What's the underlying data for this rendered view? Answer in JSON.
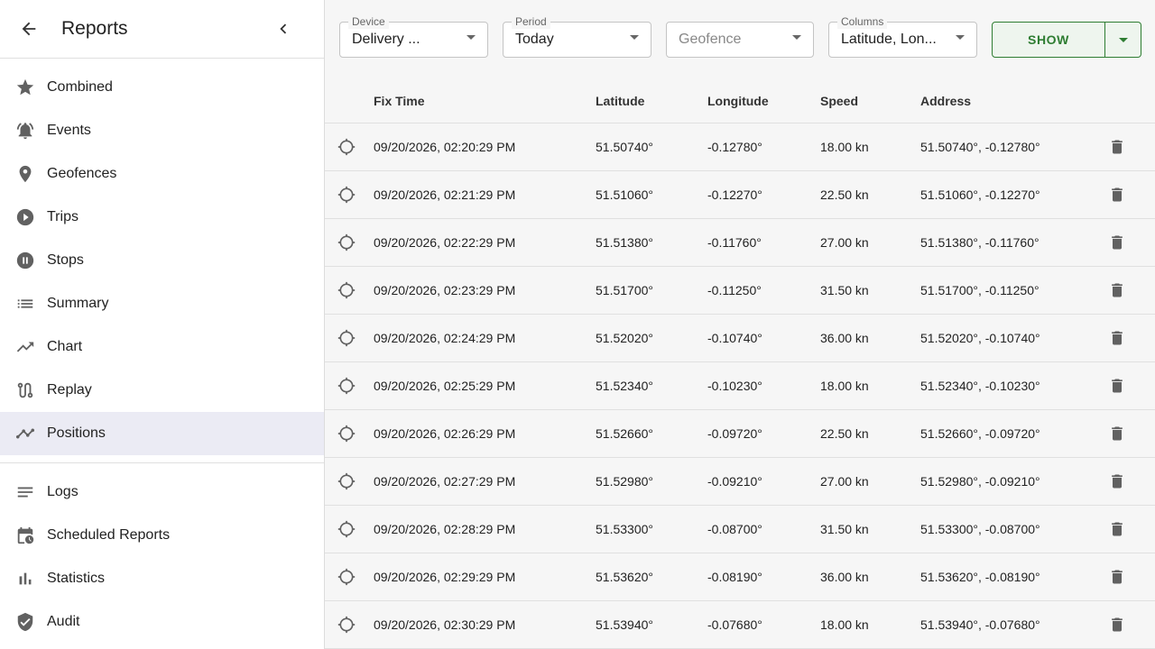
{
  "sidebar": {
    "title": "Reports",
    "top_items": [
      {
        "label": "Combined",
        "icon": "star-icon"
      },
      {
        "label": "Events",
        "icon": "bell-icon"
      },
      {
        "label": "Geofences",
        "icon": "map-pin-icon"
      },
      {
        "label": "Trips",
        "icon": "play-circle-icon"
      },
      {
        "label": "Stops",
        "icon": "pause-circle-icon"
      },
      {
        "label": "Summary",
        "icon": "list-icon"
      },
      {
        "label": "Chart",
        "icon": "trending-up-icon"
      },
      {
        "label": "Replay",
        "icon": "route-icon"
      },
      {
        "label": "Positions",
        "icon": "timeline-icon",
        "active": true
      }
    ],
    "bottom_items": [
      {
        "label": "Logs",
        "icon": "notes-icon"
      },
      {
        "label": "Scheduled Reports",
        "icon": "calendar-schedule-icon"
      },
      {
        "label": "Statistics",
        "icon": "bar-chart-icon"
      },
      {
        "label": "Audit",
        "icon": "shield-check-icon"
      }
    ]
  },
  "filters": {
    "device": {
      "label": "Device",
      "value": "Delivery ..."
    },
    "period": {
      "label": "Period",
      "value": "Today"
    },
    "geofence": {
      "placeholder": "Geofence"
    },
    "columns": {
      "label": "Columns",
      "value": "Latitude, Lon..."
    },
    "show_label": "SHOW"
  },
  "table": {
    "headers": {
      "fix_time": "Fix Time",
      "latitude": "Latitude",
      "longitude": "Longitude",
      "speed": "Speed",
      "address": "Address"
    },
    "rows": [
      {
        "fix_time": "09/20/2026, 02:20:29 PM",
        "latitude": "51.50740°",
        "longitude": "-0.12780°",
        "speed": "18.00 kn",
        "address": "51.50740°, -0.12780°"
      },
      {
        "fix_time": "09/20/2026, 02:21:29 PM",
        "latitude": "51.51060°",
        "longitude": "-0.12270°",
        "speed": "22.50 kn",
        "address": "51.51060°, -0.12270°"
      },
      {
        "fix_time": "09/20/2026, 02:22:29 PM",
        "latitude": "51.51380°",
        "longitude": "-0.11760°",
        "speed": "27.00 kn",
        "address": "51.51380°, -0.11760°"
      },
      {
        "fix_time": "09/20/2026, 02:23:29 PM",
        "latitude": "51.51700°",
        "longitude": "-0.11250°",
        "speed": "31.50 kn",
        "address": "51.51700°, -0.11250°"
      },
      {
        "fix_time": "09/20/2026, 02:24:29 PM",
        "latitude": "51.52020°",
        "longitude": "-0.10740°",
        "speed": "36.00 kn",
        "address": "51.52020°, -0.10740°"
      },
      {
        "fix_time": "09/20/2026, 02:25:29 PM",
        "latitude": "51.52340°",
        "longitude": "-0.10230°",
        "speed": "18.00 kn",
        "address": "51.52340°, -0.10230°"
      },
      {
        "fix_time": "09/20/2026, 02:26:29 PM",
        "latitude": "51.52660°",
        "longitude": "-0.09720°",
        "speed": "22.50 kn",
        "address": "51.52660°, -0.09720°"
      },
      {
        "fix_time": "09/20/2026, 02:27:29 PM",
        "latitude": "51.52980°",
        "longitude": "-0.09210°",
        "speed": "27.00 kn",
        "address": "51.52980°, -0.09210°"
      },
      {
        "fix_time": "09/20/2026, 02:28:29 PM",
        "latitude": "51.53300°",
        "longitude": "-0.08700°",
        "speed": "31.50 kn",
        "address": "51.53300°, -0.08700°"
      },
      {
        "fix_time": "09/20/2026, 02:29:29 PM",
        "latitude": "51.53620°",
        "longitude": "-0.08190°",
        "speed": "36.00 kn",
        "address": "51.53620°, -0.08190°"
      },
      {
        "fix_time": "09/20/2026, 02:30:29 PM",
        "latitude": "51.53940°",
        "longitude": "-0.07680°",
        "speed": "18.00 kn",
        "address": "51.53940°, -0.07680°"
      }
    ]
  },
  "colors": {
    "accent": "#2e7d32",
    "active_item_bg": "#ebebf4",
    "icon": "#616161"
  }
}
